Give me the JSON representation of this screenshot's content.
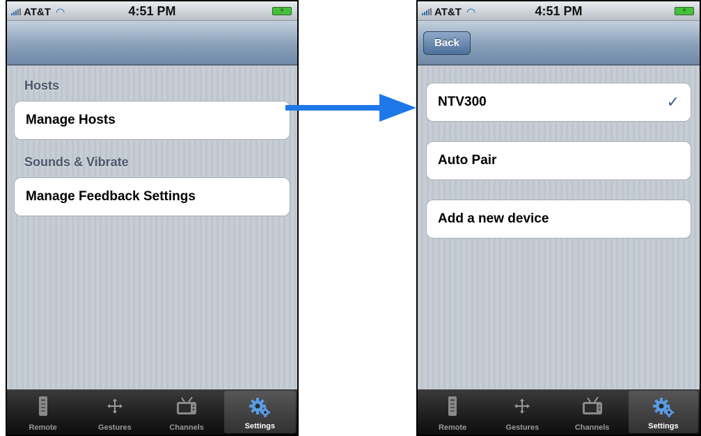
{
  "left_screen": {
    "status": {
      "carrier": "AT&T",
      "time": "4:51 PM"
    },
    "sections": [
      {
        "header": "Hosts",
        "cells": [
          "Manage Hosts"
        ]
      },
      {
        "header": "Sounds & Vibrate",
        "cells": [
          "Manage Feedback Settings"
        ]
      }
    ]
  },
  "right_screen": {
    "status": {
      "carrier": "AT&T",
      "time": "4:51 PM"
    },
    "navbar": {
      "back_label": "Back"
    },
    "cells": [
      {
        "label": "NTV300",
        "checked": true
      },
      {
        "label": "Auto Pair"
      },
      {
        "label": "Add a new device"
      }
    ],
    "checkmark": "✓"
  },
  "tabbar": {
    "tabs": [
      {
        "label": "Remote",
        "icon": "remote-icon"
      },
      {
        "label": "Gestures",
        "icon": "gestures-icon"
      },
      {
        "label": "Channels",
        "icon": "tv-icon"
      },
      {
        "label": "Settings",
        "icon": "gear-icon",
        "active": true
      }
    ]
  },
  "colors": {
    "arrow": "#1e78e8",
    "tab_active_icon": "#4a8fe0",
    "checkmark": "#365b8f"
  }
}
